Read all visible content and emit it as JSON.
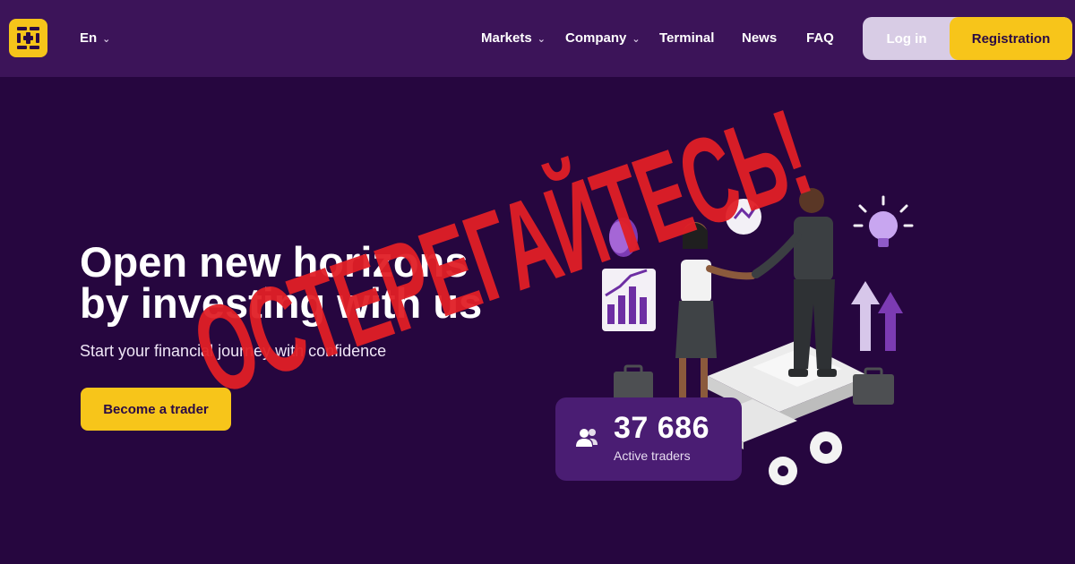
{
  "header": {
    "language": "En",
    "nav": [
      {
        "label": "Markets",
        "has_dropdown": true
      },
      {
        "label": "Company",
        "has_dropdown": true
      },
      {
        "label": "Terminal",
        "has_dropdown": false
      },
      {
        "label": "News",
        "has_dropdown": false
      },
      {
        "label": "FAQ",
        "has_dropdown": false
      }
    ],
    "login_label": "Log in",
    "register_label": "Registration"
  },
  "hero": {
    "title_line1": "Open new horizons",
    "title_line2": "by investing with us",
    "subtitle": "Start your financial journey with confidence",
    "cta_label": "Become a trader"
  },
  "stats": {
    "active_traders_count": "37 686",
    "active_traders_label": "Active traders"
  },
  "overlay": {
    "stamp_text": "ОСТЕРЕГАЙТЕСЬ!"
  },
  "colors": {
    "background": "#26063f",
    "header": "#3c1459",
    "accent_yellow": "#f7c51a",
    "stamp_red": "#e11f26",
    "card": "#4a1d73"
  },
  "icons": {
    "logo": "brand-logo-icon",
    "dropdown": "chevron-down-icon",
    "users": "users-icon"
  }
}
